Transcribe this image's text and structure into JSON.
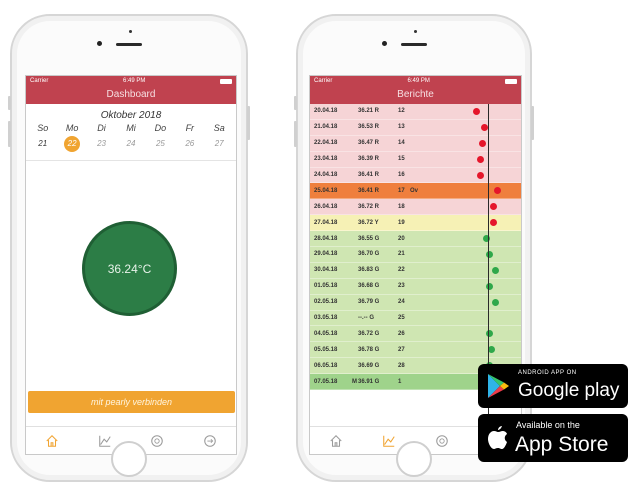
{
  "dashboard": {
    "status": {
      "carrier": "Carrier",
      "time": "6:49 PM"
    },
    "title": "Dashboard",
    "month": "Oktober 2018",
    "weekdays": [
      "So",
      "Mo",
      "Di",
      "Mi",
      "Do",
      "Fr",
      "Sa"
    ],
    "dates": [
      "21",
      "22",
      "23",
      "24",
      "25",
      "26",
      "27"
    ],
    "selected_index": 1,
    "temperature": "36.24°C",
    "connect_button": "mit pearly verbinden"
  },
  "reports": {
    "status": {
      "carrier": "Carrier",
      "time": "6:49 PM"
    },
    "title": "Berichte",
    "rows": [
      {
        "date": "20.04.18",
        "flag": "",
        "temp": "36.21 R",
        "day": "12",
        "note": "",
        "phase": "red",
        "dot": 0.6
      },
      {
        "date": "21.04.18",
        "flag": "",
        "temp": "36.53 R",
        "day": "13",
        "note": "",
        "phase": "red",
        "dot": 0.64
      },
      {
        "date": "22.04.18",
        "flag": "",
        "temp": "36.47 R",
        "day": "14",
        "note": "",
        "phase": "red",
        "dot": 0.63
      },
      {
        "date": "23.04.18",
        "flag": "",
        "temp": "36.39 R",
        "day": "15",
        "note": "",
        "phase": "red",
        "dot": 0.62
      },
      {
        "date": "24.04.18",
        "flag": "",
        "temp": "36.41 R",
        "day": "16",
        "note": "",
        "phase": "red",
        "dot": 0.62
      },
      {
        "date": "25.04.18",
        "flag": "",
        "temp": "36.41 R",
        "day": "17",
        "note": "Ov",
        "phase": "ovulation",
        "dot": 0.7
      },
      {
        "date": "26.04.18",
        "flag": "",
        "temp": "36.72 R",
        "day": "18",
        "note": "",
        "phase": "red",
        "dot": 0.68
      },
      {
        "date": "27.04.18",
        "flag": "",
        "temp": "36.72 Y",
        "day": "19",
        "note": "",
        "phase": "yellow",
        "dot": 0.68
      },
      {
        "date": "28.04.18",
        "flag": "",
        "temp": "36.55 G",
        "day": "20",
        "note": "",
        "phase": "green",
        "dot": 0.65
      },
      {
        "date": "29.04.18",
        "flag": "",
        "temp": "36.70 G",
        "day": "21",
        "note": "",
        "phase": "green",
        "dot": 0.66
      },
      {
        "date": "30.04.18",
        "flag": "",
        "temp": "36.83 G",
        "day": "22",
        "note": "",
        "phase": "green",
        "dot": 0.69
      },
      {
        "date": "01.05.18",
        "flag": "",
        "temp": "36.68 G",
        "day": "23",
        "note": "",
        "phase": "green",
        "dot": 0.66
      },
      {
        "date": "02.05.18",
        "flag": "",
        "temp": "36.79 G",
        "day": "24",
        "note": "",
        "phase": "green",
        "dot": 0.69
      },
      {
        "date": "03.05.18",
        "flag": "",
        "temp": "--.-- G",
        "day": "25",
        "note": "",
        "phase": "green",
        "dot": null
      },
      {
        "date": "04.05.18",
        "flag": "",
        "temp": "36.72 G",
        "day": "26",
        "note": "",
        "phase": "green",
        "dot": 0.66
      },
      {
        "date": "05.05.18",
        "flag": "",
        "temp": "36.78 G",
        "day": "27",
        "note": "",
        "phase": "green",
        "dot": 0.67
      },
      {
        "date": "06.05.18",
        "flag": "",
        "temp": "36.69 G",
        "day": "28",
        "note": "",
        "phase": "green",
        "dot": 0.66
      },
      {
        "date": "07.05.18",
        "flag": "M",
        "temp": "36.91 G",
        "day": "1",
        "note": "",
        "phase": "green-dark",
        "dot": null
      }
    ]
  },
  "colors": {
    "brand": "#c0424f",
    "accent": "#f0a431",
    "red_row": "#f6d4d6",
    "ovulation_row": "#ef7f3d",
    "yellow_row": "#f6f1b5",
    "green_row": "#cfe6b2",
    "green_dark_row": "#9fd38b",
    "dot_red": "#e5162b",
    "dot_green": "#2fa84a",
    "temp_circle": "#2c7d46"
  },
  "tabs": [
    {
      "name": "home",
      "icon": "home-icon"
    },
    {
      "name": "chart",
      "icon": "chart-icon"
    },
    {
      "name": "pearly",
      "icon": "pearly-device-icon"
    },
    {
      "name": "logout",
      "icon": "logout-icon"
    }
  ],
  "badges": {
    "google": {
      "small": "ANDROID APP ON",
      "big": "Google play"
    },
    "apple": {
      "small": "Available on the",
      "big": "App Store"
    }
  }
}
